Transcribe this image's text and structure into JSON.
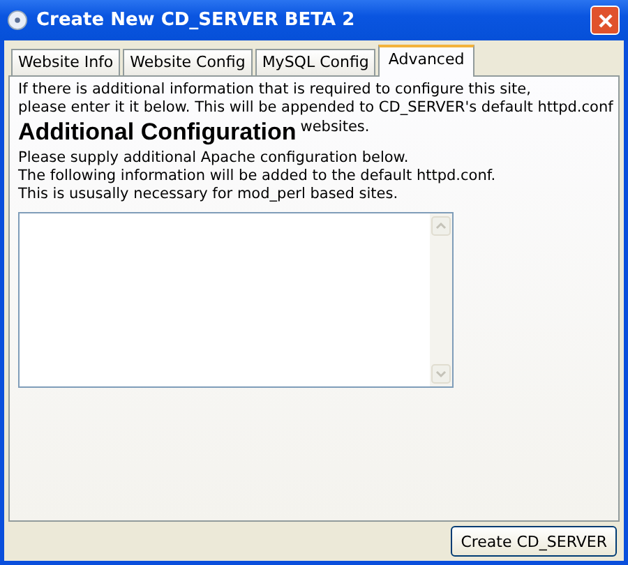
{
  "window": {
    "title": "Create New CD_SERVER BETA 2"
  },
  "tabs": [
    {
      "label": "Website Info",
      "selected": false
    },
    {
      "label": "Website Config",
      "selected": false
    },
    {
      "label": "MySQL Config",
      "selected": false
    },
    {
      "label": "Advanced",
      "selected": true
    }
  ],
  "intro": [
    "If there is additional information that is required to configure this site,",
    "please enter it it below. This will be appended to CD_SERVER's default httpd.conf"
  ],
  "heading": "Additional Configuration",
  "heading_overlap": "websites.",
  "description": [
    "Please supply additional Apache configuration below.",
    "The following information will be added to the default httpd.conf.",
    "This is ususally necessary for mod_perl based sites."
  ],
  "buttons": [
    "Create CD_SERVER"
  ]
}
